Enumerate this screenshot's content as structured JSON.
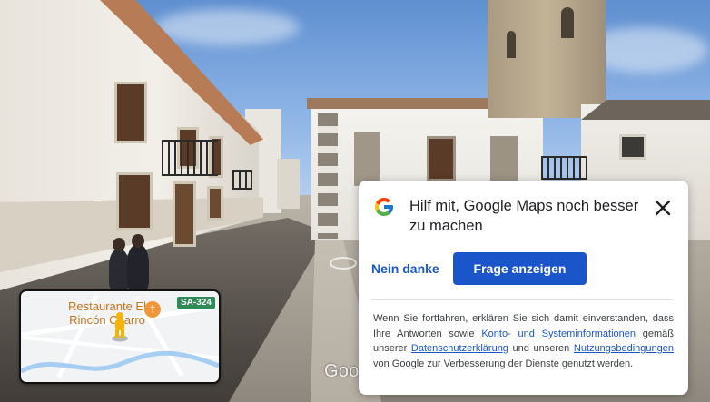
{
  "minimap": {
    "place_label": "Restaurante El Rincón Charro",
    "road_badge": "SA-324",
    "poi_icon": "restaurant-fork-knife-icon",
    "peg_icon": "pegman-icon"
  },
  "street_view": {
    "watermark": "Google"
  },
  "survey_dialog": {
    "title": "Hilf mit, Google Maps noch besser zu machen",
    "decline_label": "Nein danke",
    "accept_label": "Frage anzeigen",
    "close_icon": "close-icon",
    "legal": {
      "text_1": "Wenn Sie fortfahren, erklären Sie sich damit einverstanden, dass Ihre Antworten sowie ",
      "link_1": "Konto- und Systeminformationen",
      "text_2": " gemäß unserer ",
      "link_2": "Datenschutzerklärung",
      "text_3": " und unseren ",
      "link_3": "Nutzungsbedingungen",
      "text_4": " von Google zur Verbesserung der Dienste genutzt werden."
    }
  },
  "colors": {
    "accent_blue": "#1a56c9",
    "poi_orange": "#f29739",
    "road_badge_green": "#2e8b57"
  }
}
